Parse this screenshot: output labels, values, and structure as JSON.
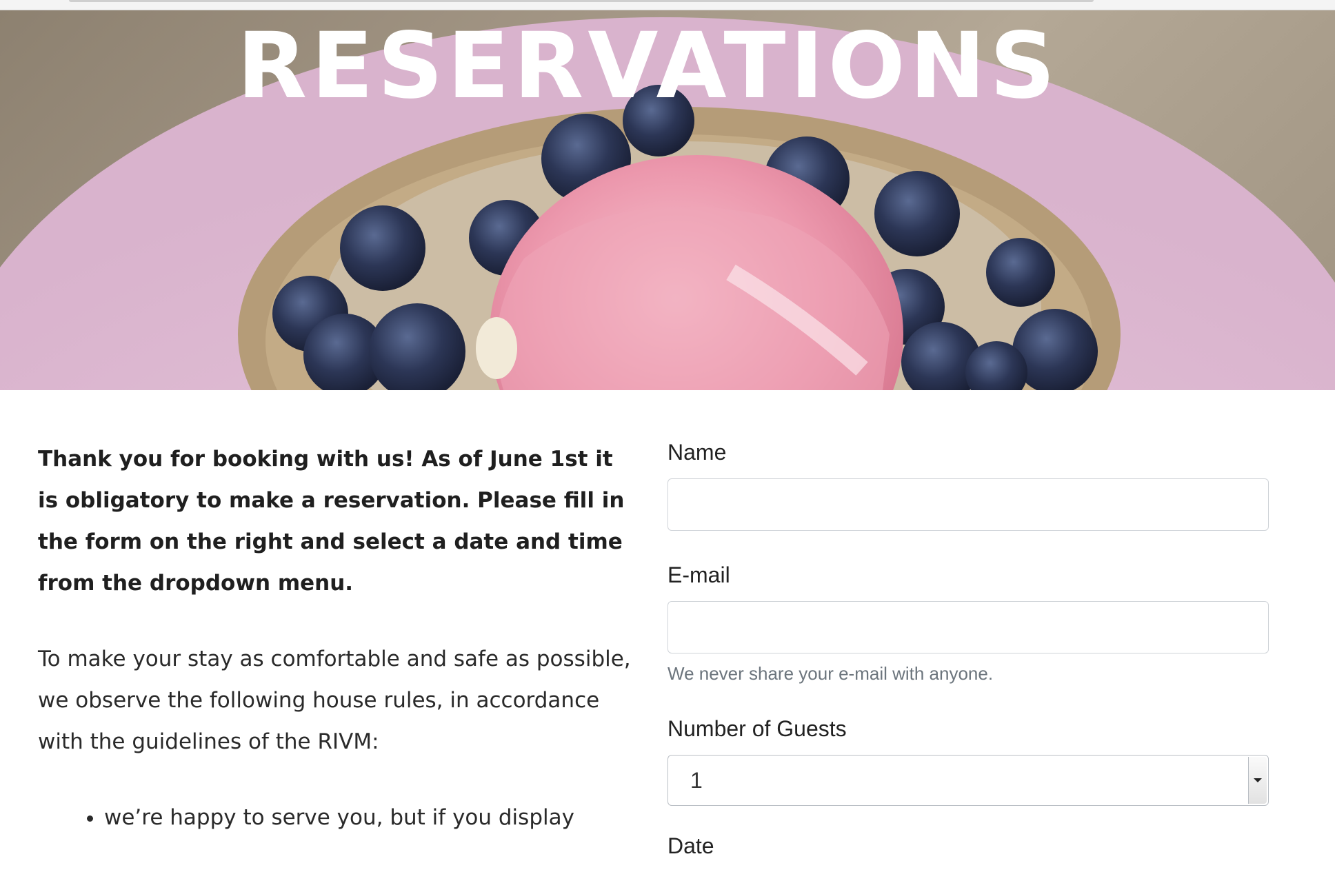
{
  "hero": {
    "title": "RESERVATIONS"
  },
  "intro": {
    "bold_text": "Thank you for booking with us! As of June 1st it is obligatory to make a reservation. Please fill in the form on the right and select a date and time from the dropdown menu.",
    "rules_text": "To make your stay as comfortable and safe as possible, we observe the following house rules, in accordance with the guidelines of the RIVM:",
    "rules": [
      "we’re happy to serve you, but if you display"
    ]
  },
  "form": {
    "name": {
      "label": "Name",
      "value": ""
    },
    "email": {
      "label": "E-mail",
      "value": "",
      "helper": "We never share your e-mail with anyone."
    },
    "guests": {
      "label": "Number of Guests",
      "selected": "1"
    },
    "date": {
      "label": "Date"
    }
  }
}
